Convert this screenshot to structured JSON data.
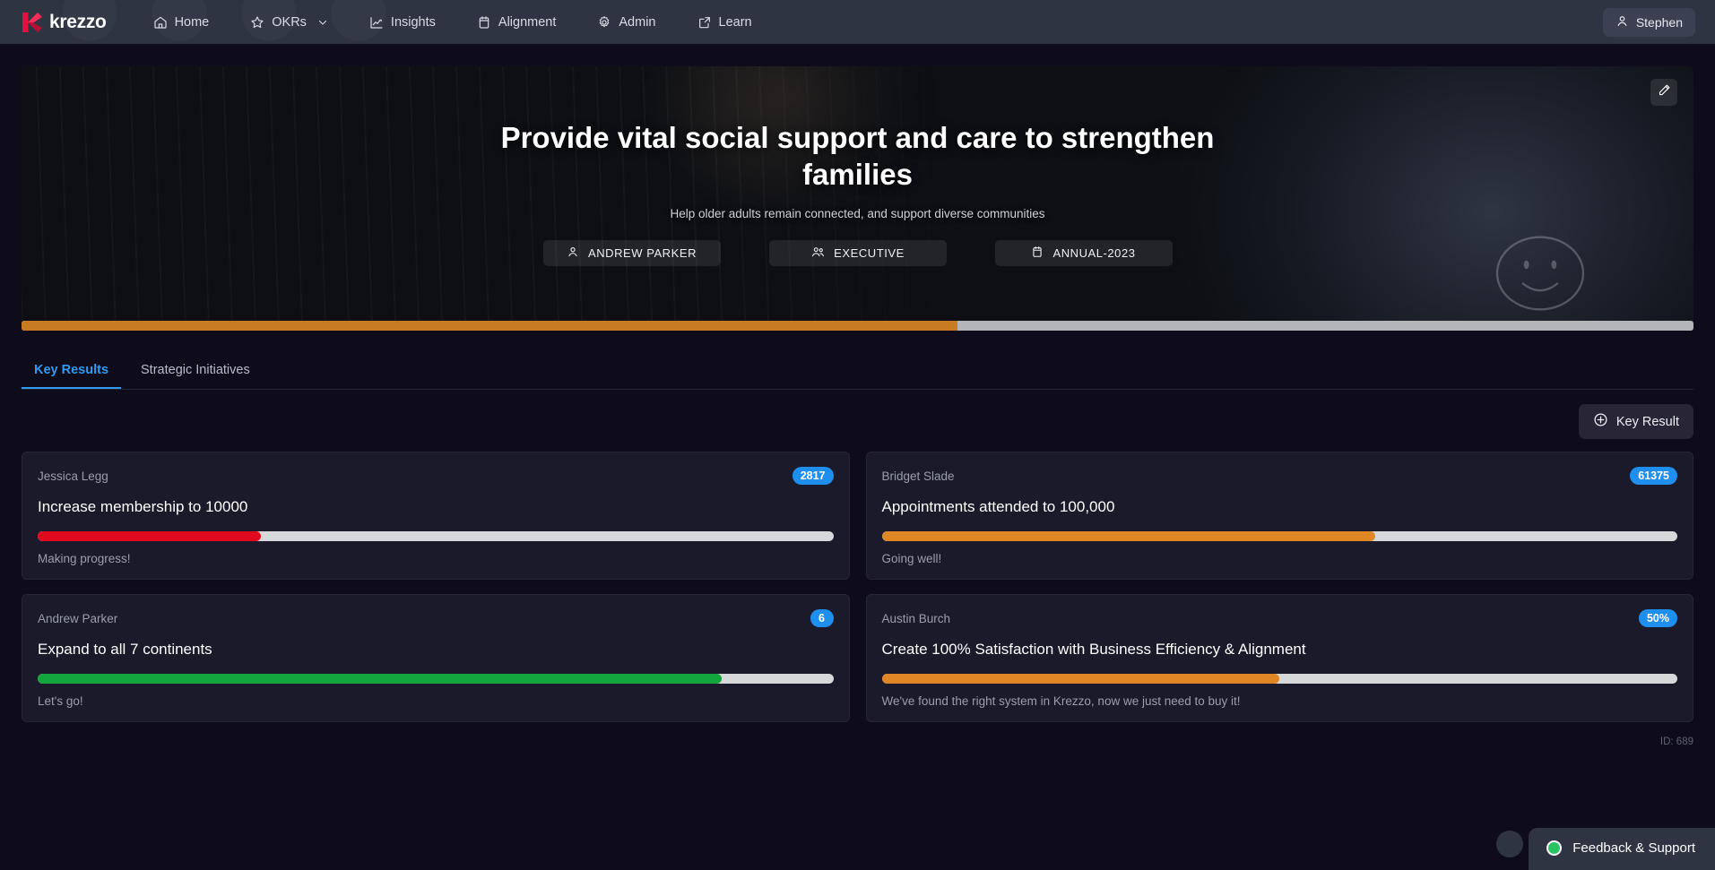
{
  "nav": {
    "brand": "krezzo",
    "items": [
      {
        "label": "Home",
        "icon": "home-icon"
      },
      {
        "label": "OKRs",
        "icon": "star-icon",
        "chevron": "chevron-down-icon"
      },
      {
        "label": "Insights",
        "icon": "chart-line-icon"
      },
      {
        "label": "Alignment",
        "icon": "calendar-icon"
      },
      {
        "label": "Admin",
        "icon": "gear-icon"
      },
      {
        "label": "Learn",
        "icon": "external-link-icon"
      }
    ],
    "user": {
      "name": "Stephen",
      "icon": "person-icon"
    }
  },
  "hero": {
    "title": "Provide vital social support and care to strengthen families",
    "subtitle": "Help older adults remain connected, and support diverse communities",
    "edit_icon": "pencil-icon",
    "pills": [
      {
        "label": "ANDREW PARKER",
        "icon": "person-icon"
      },
      {
        "label": "EXECUTIVE",
        "icon": "people-icon"
      },
      {
        "label": "ANNUAL-2023",
        "icon": "calendar-icon"
      }
    ],
    "progress_percent": 56,
    "progress_color": "#c97b22",
    "progress_track_color": "#b3b5b9"
  },
  "tabs": [
    {
      "label": "Key Results",
      "active": true
    },
    {
      "label": "Strategic Initiatives",
      "active": false
    }
  ],
  "actions": {
    "add_key_result": "Key Result",
    "add_icon": "plus-circle-icon"
  },
  "key_results": [
    {
      "owner": "Jessica Legg",
      "badge": "2817",
      "title": "Increase membership to 10000",
      "progress_percent": 28,
      "bar_color": "#e00a1e",
      "note": "Making progress!"
    },
    {
      "owner": "Bridget Slade",
      "badge": "61375",
      "title": "Appointments attended to 100,000",
      "progress_percent": 62,
      "bar_color": "#e08725",
      "note": "Going well!"
    },
    {
      "owner": "Andrew Parker",
      "badge": "6",
      "title": "Expand to all 7 continents",
      "progress_percent": 86,
      "bar_color": "#12a63c",
      "note": "Let's go!"
    },
    {
      "owner": "Austin Burch",
      "badge": "50%",
      "title": "Create 100% Satisfaction with Business Efficiency & Alignment",
      "progress_percent": 50,
      "bar_color": "#e08725",
      "note": "We've found the right system in Krezzo, now we just need to buy it!"
    }
  ],
  "footer": {
    "id_label": "ID: 689"
  },
  "feedback": {
    "label": "Feedback & Support",
    "status_color": "#2bc463",
    "icon": "status-dot-icon"
  },
  "colors": {
    "accent_blue": "#1f8fef",
    "tab_active": "#2f9bf2",
    "nav_bg": "#2f3443",
    "page_bg": "#0e0c1a",
    "card_bg": "#1b1a2b"
  }
}
